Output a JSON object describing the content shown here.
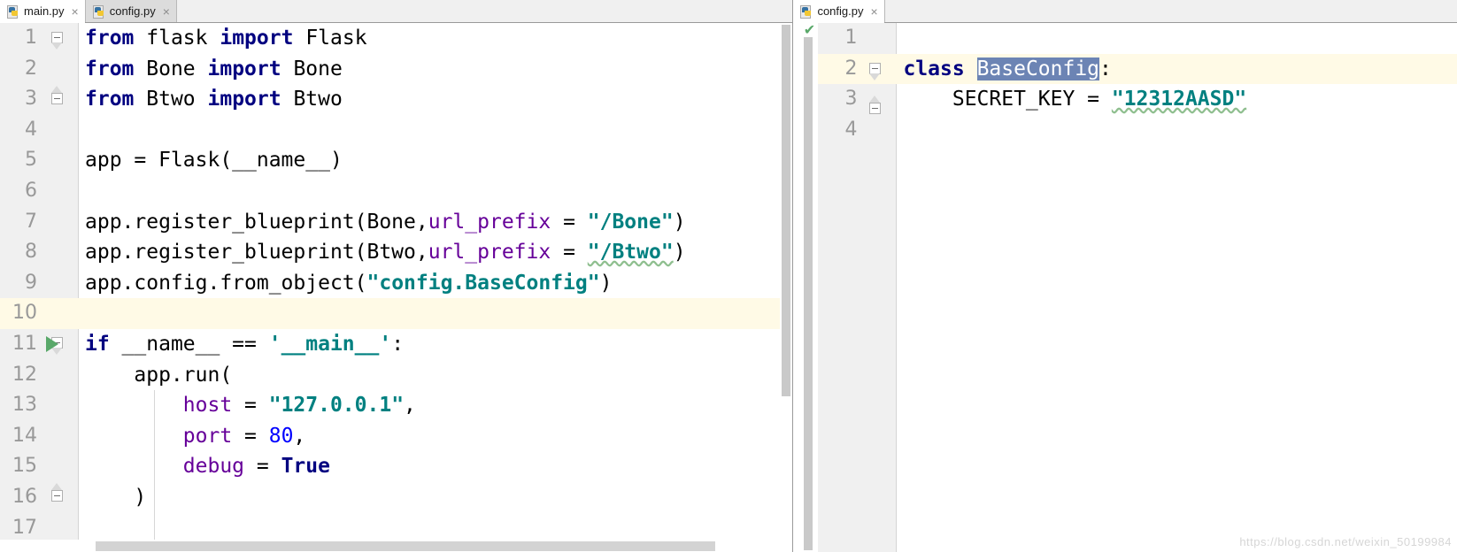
{
  "left_pane": {
    "tabs": [
      {
        "label": "main.py",
        "icon": "python-file-icon",
        "active": true,
        "close": "×"
      },
      {
        "label": "config.py",
        "icon": "python-file-icon",
        "active": false,
        "close": "×"
      }
    ],
    "inspection_status_icon": "green-checkmark-icon",
    "caret_line": 10,
    "lines": [
      {
        "n": "1",
        "text": "from flask import Flask"
      },
      {
        "n": "2",
        "text": "from Bone import Bone"
      },
      {
        "n": "3",
        "text": "from Btwo import Btwo"
      },
      {
        "n": "4",
        "text": ""
      },
      {
        "n": "5",
        "text": "app = Flask(__name__)"
      },
      {
        "n": "6",
        "text": ""
      },
      {
        "n": "7",
        "text": "app.register_blueprint(Bone,url_prefix = \"/Bone\")"
      },
      {
        "n": "8",
        "text": "app.register_blueprint(Btwo,url_prefix = \"/Btwo\")"
      },
      {
        "n": "9",
        "text": "app.config.from_object(\"config.BaseConfig\")"
      },
      {
        "n": "10",
        "text": ""
      },
      {
        "n": "11",
        "text": "if __name__ == '__main__':"
      },
      {
        "n": "12",
        "text": "    app.run("
      },
      {
        "n": "13",
        "text": "        host = \"127.0.0.1\","
      },
      {
        "n": "14",
        "text": "        port = 80,"
      },
      {
        "n": "15",
        "text": "        debug = True"
      },
      {
        "n": "16",
        "text": "    )"
      },
      {
        "n": "17",
        "text": ""
      }
    ]
  },
  "right_pane": {
    "tabs": [
      {
        "label": "config.py",
        "icon": "python-file-icon",
        "active": true,
        "close": "×"
      }
    ],
    "inspection_status_icon": "green-checkmark-icon",
    "caret_line": 2,
    "selection_text": "BaseConfig",
    "lines": [
      {
        "n": "1",
        "text": ""
      },
      {
        "n": "2",
        "text": "class BaseConfig:"
      },
      {
        "n": "3",
        "text": "    SECRET_KEY = \"12312AASD\""
      },
      {
        "n": "4",
        "text": ""
      }
    ]
  },
  "tokens": {
    "kw_from": "from",
    "kw_import": "import",
    "kw_if": "if",
    "kw_class": "class",
    "kw_true": "True",
    "id_flask_mod": "flask",
    "id_Flask": "Flask",
    "id_Bone": "Bone",
    "id_Btwo": "Btwo",
    "l5": "app = Flask(__name__)",
    "l7a": "app.register_blueprint(Bone,",
    "l7b": "url_prefix",
    "l7c": " = ",
    "l7d": "\"/Bone\"",
    "l7e": ")",
    "l8a": "app.register_blueprint(Btwo,",
    "l8d": "\"/Btwo\"",
    "l9a": "app.config.from_object(",
    "l9b": "\"config.BaseConfig\"",
    "l9c": ")",
    "l11a": " __name__ == ",
    "l11b": "'__main__'",
    "l11c": ":",
    "l12": "    app.run(",
    "l13a": "        ",
    "l13b": "host",
    "l13c": " = ",
    "l13d": "\"127.0.0.1\"",
    "l13e": ",",
    "l14b": "port",
    "l14d": "80",
    "l14e": ",",
    "l15b": "debug",
    "l15d": "True",
    "l16": "    )",
    "r2b": "BaseConfig",
    "r2c": ":",
    "r3a": "    SECRET_KEY = ",
    "r3b": "\"12312AASD\""
  },
  "colors": {
    "keyword": "#000080",
    "string": "#008080",
    "kwarg": "#660099",
    "number": "#0000ff",
    "caret_line_bg": "#fffae6",
    "selection_bg": "#6c84b4",
    "gutter_bg": "#f0f0f0",
    "run_icon": "#59a869",
    "squiggle": "#8fbf8f"
  },
  "watermark": {
    "text": "https://blog.csdn.net/weixin_50199984"
  },
  "icons": {
    "checkmark": "✔"
  }
}
